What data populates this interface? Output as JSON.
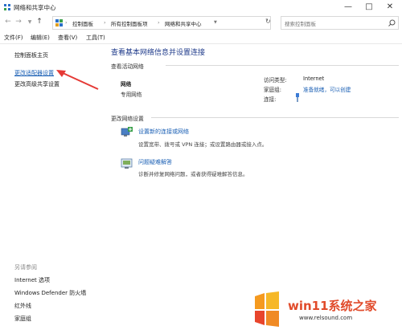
{
  "window": {
    "title": "网络和共享中心"
  },
  "address": {
    "crumbs": [
      "控制面板",
      "所有控制面板项",
      "网络和共享中心"
    ],
    "search_placeholder": "搜索控制面板"
  },
  "menu": {
    "file": "文件(F)",
    "edit": "编辑(E)",
    "view": "查看(V)",
    "tools": "工具(T)"
  },
  "sidebar": {
    "home": "控制面板主页",
    "adapter": "更改适配器设置",
    "advanced": "更改高级共享设置",
    "see_also": "另请参阅",
    "links": [
      "Internet 选项",
      "Windows Defender 防火墙",
      "红外线",
      "家庭组"
    ]
  },
  "main": {
    "heading": "查看基本网络信息并设置连接",
    "active_networks": "查看活动网络",
    "network_name": "网络",
    "network_type": "专用网络",
    "access_type_label": "访问类型:",
    "access_type_value": "Internet",
    "homegroup_label": "家庭组:",
    "homegroup_value": "准备就绪，可以创建",
    "connection_label": "连接:",
    "change_settings": "更改网络设置",
    "new_conn_title": "设置新的连接或网络",
    "new_conn_desc": "设置宽带、拨号或 VPN 连接；或设置路由器或接入点。",
    "troubleshoot_title": "问题疑难解答",
    "troubleshoot_desc": "诊断并修复网络问题，或者获得疑难解答信息。"
  },
  "watermark": {
    "text": "win11系统之家",
    "url": "www.relsound.com"
  }
}
